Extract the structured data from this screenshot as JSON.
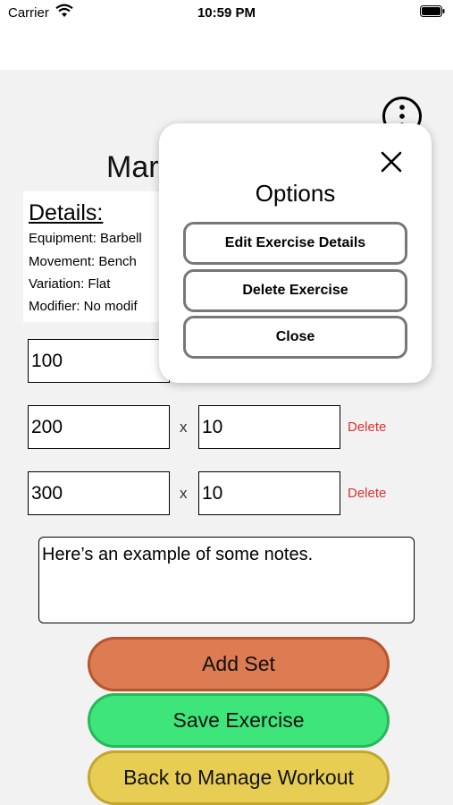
{
  "status_bar": {
    "carrier": "Carrier",
    "time": "10:59 PM"
  },
  "icons": {
    "wifi": "wifi-icon",
    "battery": "battery-icon",
    "menu": "more-options-icon",
    "close": "close-icon"
  },
  "page": {
    "title_fragment": "Mar"
  },
  "details": {
    "heading": "Details:",
    "lines": [
      "Equipment: Barbell",
      "Movement: Bench",
      "Variation: Flat",
      "Modifier: No modif"
    ]
  },
  "sets": [
    {
      "weight": "100",
      "reps": ""
    },
    {
      "weight": "200",
      "separator": "x",
      "reps": "10",
      "delete_label": "Delete"
    },
    {
      "weight": "300",
      "separator": "x",
      "reps": "10",
      "delete_label": "Delete"
    }
  ],
  "notes": {
    "value": "Here’s an example of some notes."
  },
  "buttons": {
    "add_set": "Add Set",
    "save_exercise": "Save Exercise",
    "back": "Back to Manage Workout"
  },
  "colors": {
    "add_set": "#dd7b52",
    "save_exercise": "#3ee57a",
    "back": "#e8cd55",
    "delete": "#e03030"
  },
  "options_popup": {
    "title": "Options",
    "edit": "Edit Exercise Details",
    "delete": "Delete Exercise",
    "close": "Close"
  }
}
